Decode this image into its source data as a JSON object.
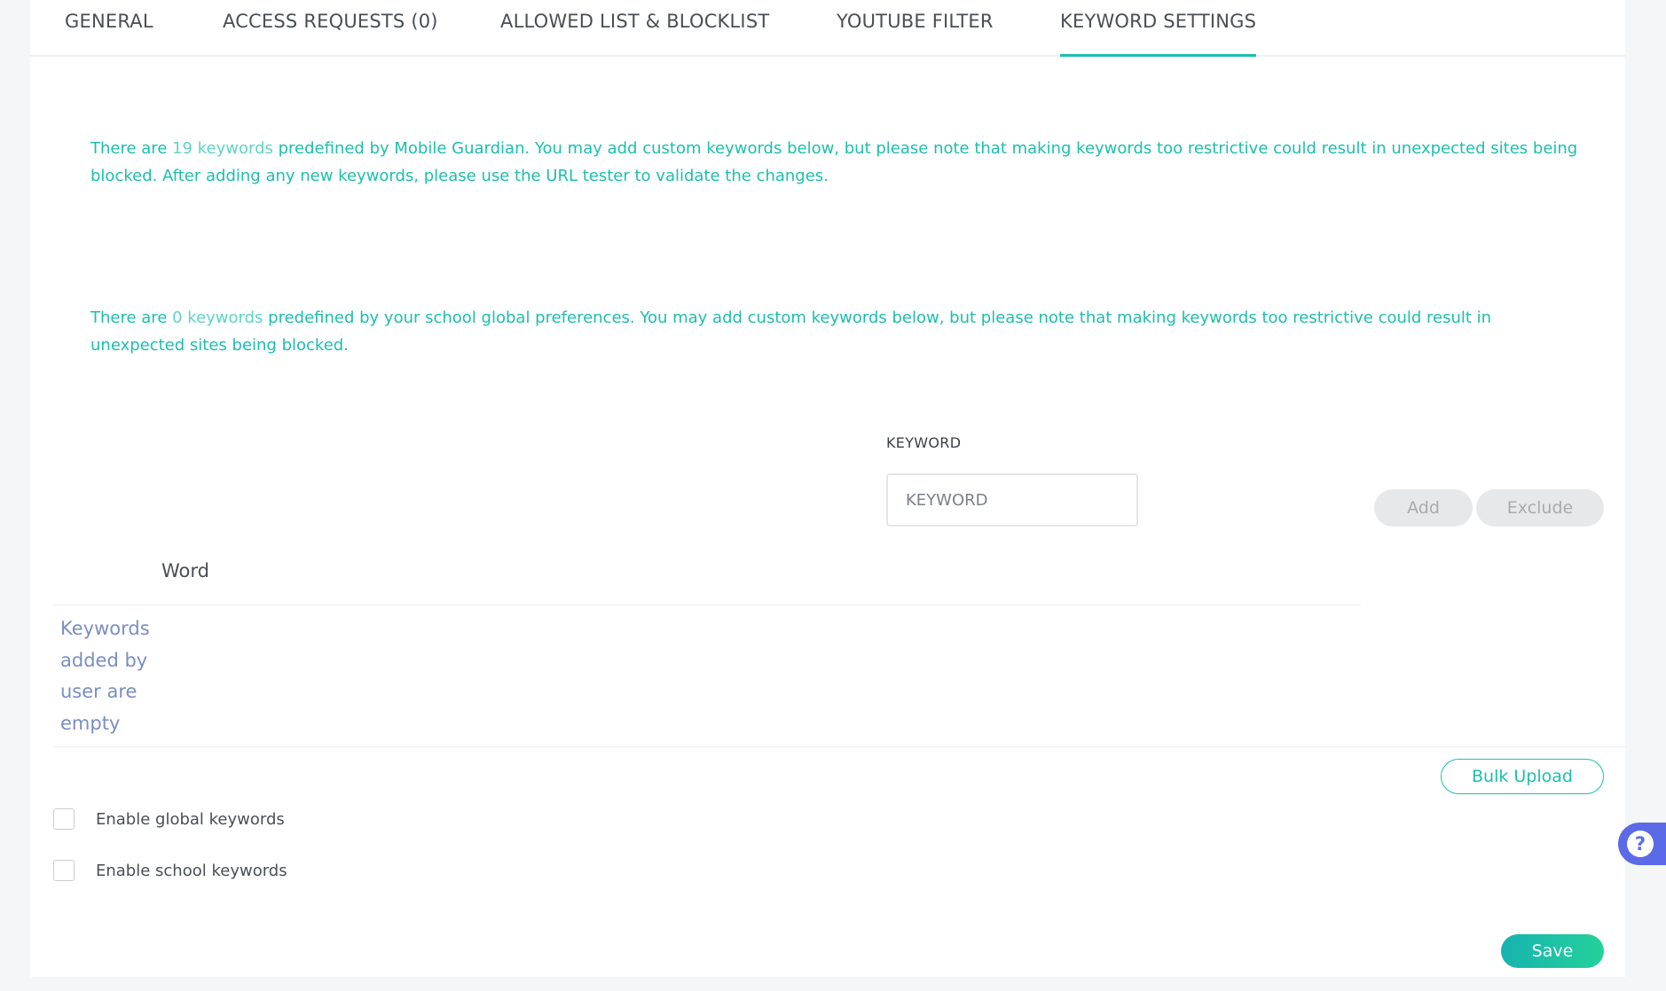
{
  "tabs": [
    {
      "label": "GENERAL"
    },
    {
      "label": "ACCESS REQUESTS (0)"
    },
    {
      "label": "ALLOWED LIST & BLOCKLIST"
    },
    {
      "label": "YOUTUBE FILTER"
    },
    {
      "label": "KEYWORD SETTINGS",
      "active": true
    }
  ],
  "info1": {
    "prefix": "There are ",
    "link": "19 keywords",
    "suffix": " predefined by Mobile Guardian. You may add custom keywords below, but please note that making keywords too restrictive could result in unexpected sites being blocked. After adding any new keywords, please use the URL tester to validate the changes."
  },
  "info2": {
    "prefix": "There are ",
    "link": "0 keywords",
    "suffix": " predefined by your school global preferences. You may add custom keywords below, but please note that making keywords too restrictive could result in unexpected sites being blocked."
  },
  "keyword": {
    "label": "KEYWORD",
    "placeholder": "KEYWORD",
    "value": ""
  },
  "buttons": {
    "add": "Add",
    "exclude": "Exclude",
    "bulk_upload": "Bulk Upload",
    "save": "Save"
  },
  "table": {
    "column_header": "Word",
    "empty_message": "Keywords added by user are empty"
  },
  "checkboxes": [
    {
      "label": "Enable global keywords",
      "checked": false
    },
    {
      "label": "Enable school keywords",
      "checked": false
    }
  ],
  "help": {
    "icon": "question-icon",
    "glyph": "?"
  },
  "colors": {
    "accent": "#1bbfae",
    "accent_light": "#5fd3c6",
    "empty_text": "#7a8ec2",
    "help_bg": "#5b6ae6"
  }
}
